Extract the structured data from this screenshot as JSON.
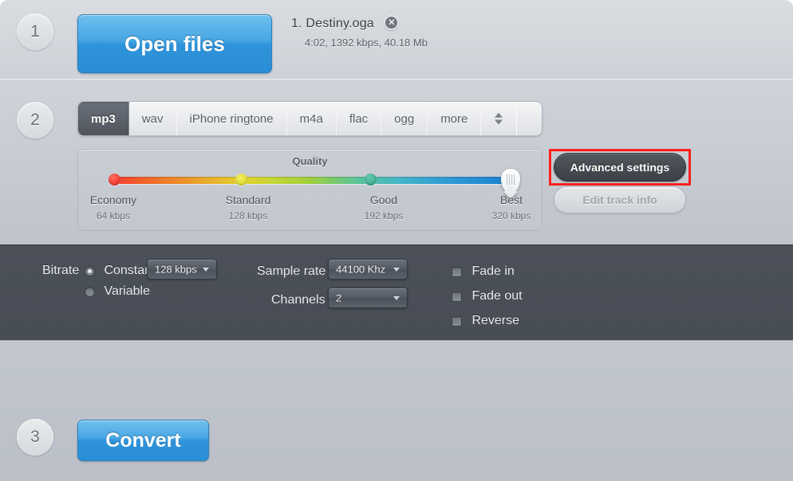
{
  "step1": {
    "number": "1",
    "open_files_label": "Open files",
    "file": {
      "name": "1. Destiny.oga",
      "remove_icon": "close-circle-icon",
      "remove_glyph": "✕",
      "meta": "4:02, 1392 kbps, 40.18 Mb"
    }
  },
  "step2": {
    "number": "2",
    "format_tabs": [
      {
        "label": "mp3",
        "active": true
      },
      {
        "label": "wav",
        "active": false
      },
      {
        "label": "iPhone ringtone",
        "active": false
      },
      {
        "label": "m4a",
        "active": false
      },
      {
        "label": "flac",
        "active": false
      },
      {
        "label": "ogg",
        "active": false
      },
      {
        "label": "more",
        "active": false
      }
    ],
    "tabs_spinner_icon": "up-down-chevron-icon",
    "quality": {
      "title": "Quality",
      "stops": [
        {
          "name": "Economy",
          "bitrate": "64 kbps",
          "color": "#e8241c"
        },
        {
          "name": "Standard",
          "bitrate": "128 kbps",
          "color": "#d9d424"
        },
        {
          "name": "Good",
          "bitrate": "192 kbps",
          "color": "#2fa184"
        },
        {
          "name": "Best",
          "bitrate": "320 kbps",
          "color": "#1d7fd0"
        }
      ],
      "selected": "Best"
    },
    "advanced_settings_label": "Advanced settings",
    "edit_track_info_label": "Edit track info",
    "highlight_color": "#ff1f1f"
  },
  "advanced": {
    "bitrate_label": "Bitrate",
    "bitrate_modes": [
      {
        "label": "Constant",
        "selected": true
      },
      {
        "label": "Variable",
        "selected": false
      }
    ],
    "bitrate_value": "128 kbps",
    "sample_rate_label": "Sample rate",
    "sample_rate_value": "44100 Khz",
    "channels_label": "Channels",
    "channels_value": "2",
    "effects": [
      {
        "label": "Fade in",
        "checked": false
      },
      {
        "label": "Fade out",
        "checked": false
      },
      {
        "label": "Reverse",
        "checked": false
      }
    ]
  },
  "step3": {
    "number": "3",
    "convert_label": "Convert"
  }
}
